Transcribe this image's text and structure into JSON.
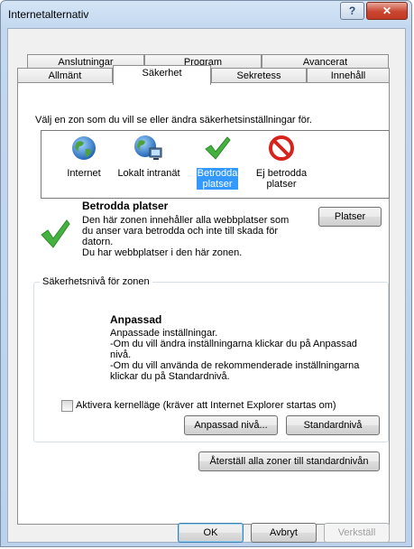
{
  "window": {
    "title": "Internetalternativ"
  },
  "tabs_back": [
    "Anslutningar",
    "Program",
    "Avancerat"
  ],
  "tabs_front": [
    "Allmänt",
    "Säkerhet",
    "Sekretess",
    "Innehåll"
  ],
  "zones": {
    "prompt": "Välj en zon som du vill se eller ändra säkerhetsinställningar för.",
    "items": [
      {
        "line1": "Internet",
        "line2": ""
      },
      {
        "line1": "Lokalt intranät",
        "line2": ""
      },
      {
        "line1": "Betrodda",
        "line2": "platser"
      },
      {
        "line1": "Ej betrodda",
        "line2": "platser"
      }
    ]
  },
  "zone_info": {
    "title": "Betrodda platser",
    "desc1": "Den här zonen innehåller alla webbplatser som",
    "desc2": "du anser vara betrodda och inte till skada för",
    "desc3": "datorn.",
    "desc4": "Du har webbplatser i den här zonen.",
    "sites_button": "Platser"
  },
  "security_level": {
    "legend": "Säkerhetsnivå för zonen",
    "name": "Anpassad",
    "line1": "Anpassade inställningar.",
    "line2": "-Om du vill ändra inställningarna klickar du på Anpassad",
    "line3": "nivå.",
    "line4": "-Om du vill använda de rekommenderade inställningarna",
    "line5": "klickar du på Standardnivå.",
    "protected_mode": "Aktivera kernelläge (kräver att Internet Explorer startas om)",
    "custom_button": "Anpassad nivå...",
    "default_button": "Standardnivå"
  },
  "reset_button": "Återställ alla zoner till standardnivån",
  "footer": {
    "ok": "OK",
    "cancel": "Avbryt",
    "apply": "Verkställ"
  }
}
